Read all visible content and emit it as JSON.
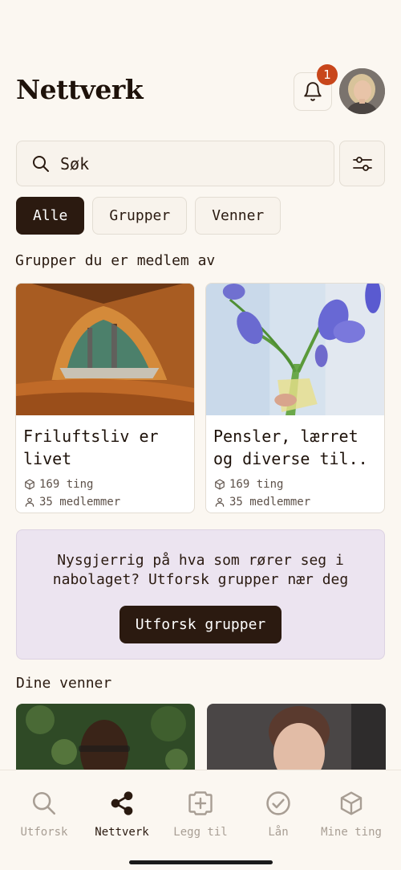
{
  "header": {
    "title": "Nettverk",
    "notification_count": "1"
  },
  "search": {
    "placeholder": "Søk"
  },
  "filters": [
    {
      "label": "Alle",
      "active": true
    },
    {
      "label": "Grupper",
      "active": false
    },
    {
      "label": "Venner",
      "active": false
    }
  ],
  "groups_section": {
    "title": "Grupper du er medlem av",
    "cards": [
      {
        "title": "Friluftsliv er livet",
        "items": "169 ting",
        "members": "35 medlemmer"
      },
      {
        "title": "Pensler, lærret og diverse til..",
        "items": "169 ting",
        "members": "35 medlemmer"
      }
    ]
  },
  "promo": {
    "text": "Nysgjerrig på hva som rører seg i nabolaget? Utforsk grupper nær deg",
    "button": "Utforsk grupper"
  },
  "friends_section": {
    "title": "Dine venner"
  },
  "tabbar": [
    {
      "label": "Utforsk",
      "icon": "search-icon",
      "active": false
    },
    {
      "label": "Nettverk",
      "icon": "share-icon",
      "active": true
    },
    {
      "label": "Legg til",
      "icon": "add-icon",
      "active": false
    },
    {
      "label": "Lån",
      "icon": "check-circle-icon",
      "active": false
    },
    {
      "label": "Mine ting",
      "icon": "box-icon",
      "active": false
    }
  ],
  "colors": {
    "background": "#fbf7f1",
    "primary": "#2b1a10",
    "badge": "#c8461b",
    "promo": "#ece4f0"
  }
}
